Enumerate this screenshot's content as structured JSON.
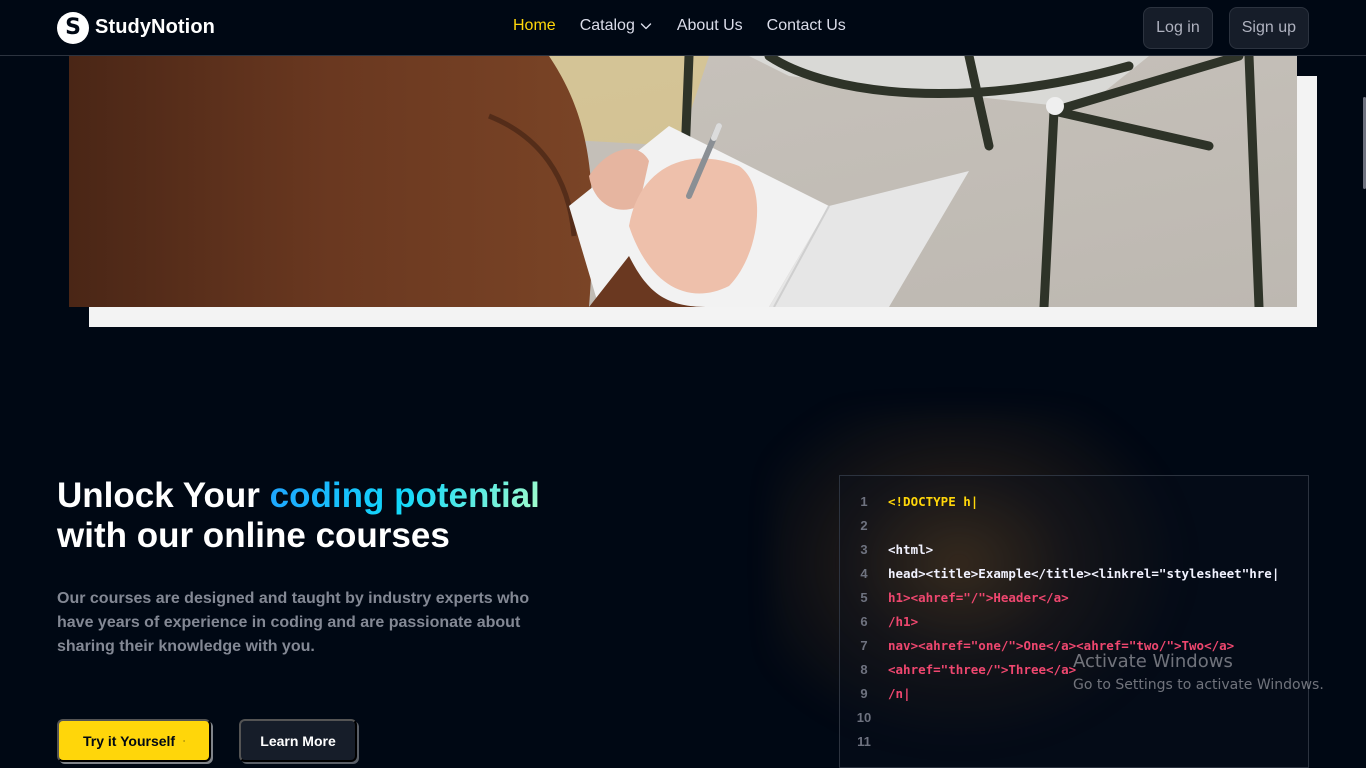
{
  "navbar": {
    "brand": "StudyNotion",
    "brand_letter": "S",
    "links": [
      {
        "label": "Home",
        "active": true
      },
      {
        "label": "Catalog",
        "dropdown": true
      },
      {
        "label": "About Us"
      },
      {
        "label": "Contact Us"
      }
    ],
    "login_label": "Log in",
    "signup_label": "Sign up"
  },
  "hero_media": {
    "description": "Hero image: person in brown hoodie writing in a notebook beside a dark metal stool"
  },
  "code_section": {
    "headline_prefix": "Unlock Your ",
    "headline_highlight": "coding potential",
    "headline_suffix": "with our online courses",
    "subtext": "Our courses are designed and taught by industry experts who have years of experience in coding and are passionate about sharing their knowledge with you.",
    "primary_button": "Try it Yourself",
    "secondary_button": "Learn More",
    "line_numbers": [
      "1",
      "2",
      "3",
      "4",
      "5",
      "6",
      "7",
      "8",
      "9",
      "10",
      "11"
    ],
    "code_lines": [
      "<!DOCTYPE h",
      "",
      "<html>",
      "head><title>Example</title><linkrel=\"stylesheet\"hre",
      "h1><ahref=\"/\">Header</a>",
      "/h1>",
      "nav><ahref=\"one/\">One</a><ahref=\"two/\">Two</a>",
      "<ahref=\"three/\">Three</a>",
      "/n"
    ]
  },
  "watermark": {
    "title": "Activate Windows",
    "subtitle": "Go to Settings to activate Windows."
  },
  "colors": {
    "background": "#000814",
    "accent_yellow": "#FFD60A",
    "code_pink": "#EF476F",
    "gradient": [
      "#1FA2FF",
      "#12D8FA",
      "#A6FFCB"
    ]
  }
}
